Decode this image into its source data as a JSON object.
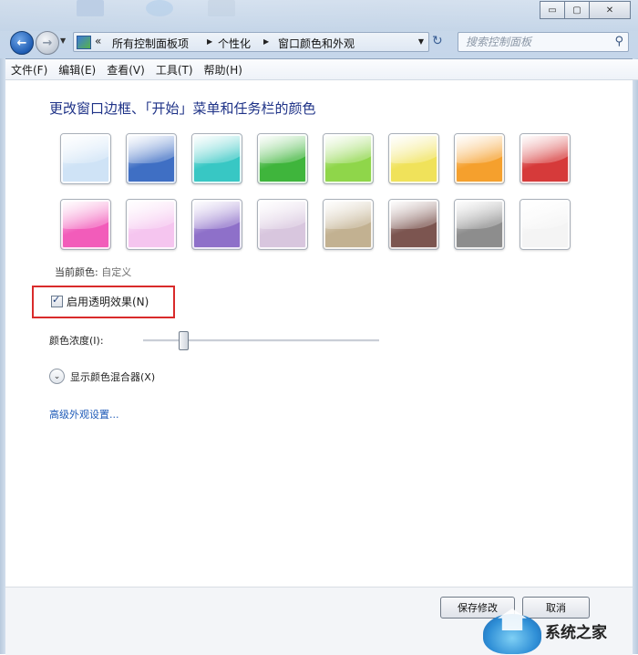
{
  "window": {
    "caption_buttons": {
      "minimize": "▭",
      "maximize": "▢",
      "close": "✕"
    }
  },
  "nav": {
    "back_icon": "back-arrow-icon",
    "forward_icon": "forward-arrow-icon",
    "overflow": "«",
    "breadcrumbs": [
      "所有控制面板项",
      "个性化",
      "窗口颜色和外观"
    ],
    "search_placeholder": "搜索控制面板"
  },
  "menu": [
    "文件(F)",
    "编辑(E)",
    "查看(V)",
    "工具(T)",
    "帮助(H)"
  ],
  "main": {
    "title": "更改窗口边框、「开始」菜单和任务栏的颜色",
    "swatches": [
      {
        "color": "#cfe3f6"
      },
      {
        "color": "#3f6fc4"
      },
      {
        "color": "#38c7c4"
      },
      {
        "color": "#3fb53c"
      },
      {
        "color": "#8fd64a"
      },
      {
        "color": "#f0e25a"
      },
      {
        "color": "#f5a02d"
      },
      {
        "color": "#d63a3a"
      },
      {
        "color": "#f25cba"
      },
      {
        "color": "#f5c5ef"
      },
      {
        "color": "#8e70c9"
      },
      {
        "color": "#d8c6de"
      },
      {
        "color": "#c2b191"
      },
      {
        "color": "#7c5550"
      },
      {
        "color": "#8d8d8d"
      },
      {
        "color": "#f4f4f4"
      }
    ],
    "current_color_label": "当前颜色:",
    "current_color_value": "自定义",
    "transparency_label": "启用透明效果(N)",
    "transparency_checked": true,
    "intensity_label": "颜色浓度(I):",
    "intensity_fraction": 0.17,
    "mixer_label": "显示颜色混合器(X)",
    "advanced_link": "高级外观设置..."
  },
  "footer": {
    "save_label": "保存修改",
    "cancel_label": "取消"
  },
  "watermark": {
    "text": "系统之家"
  },
  "colors": {
    "accent_title": "#1e3287",
    "link": "#1f5bb8",
    "highlight": "#d92b2b"
  }
}
